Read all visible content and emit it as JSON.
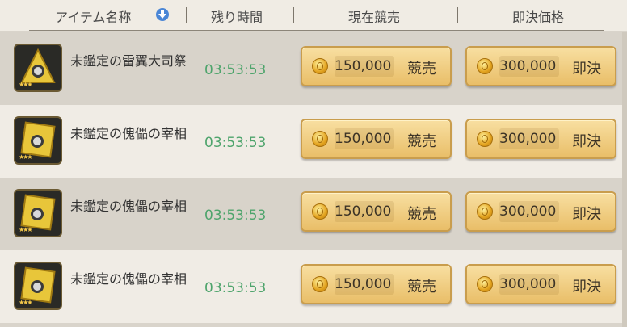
{
  "header": {
    "item_name": "アイテム名称",
    "remaining_time": "残り時間",
    "current_bid": "現在競売",
    "buyout_price": "即決価格"
  },
  "rows": [
    {
      "name": "未鑑定の雷翼大司祭",
      "time": "03:53:53",
      "bid_amount": "150,000",
      "bid_label": "競売",
      "buyout_amount": "300,000",
      "buyout_label": "即決",
      "icon": "winged-relic-icon",
      "stars": "★★★"
    },
    {
      "name": "未鑑定の傀儡の宰相",
      "time": "03:53:53",
      "bid_amount": "150,000",
      "bid_label": "競売",
      "buyout_amount": "300,000",
      "buyout_label": "即決",
      "icon": "puppet-card-icon",
      "stars": "★★★"
    },
    {
      "name": "未鑑定の傀儡の宰相",
      "time": "03:53:53",
      "bid_amount": "150,000",
      "bid_label": "競売",
      "buyout_amount": "300,000",
      "buyout_label": "即決",
      "icon": "puppet-card-icon",
      "stars": "★★★"
    },
    {
      "name": "未鑑定の傀儡の宰相",
      "time": "03:53:53",
      "bid_amount": "150,000",
      "bid_label": "競売",
      "buyout_amount": "300,000",
      "buyout_label": "即決",
      "icon": "puppet-card-icon",
      "stars": "★★★"
    }
  ],
  "colors": {
    "time_green": "#4ea46c",
    "button_gold": "#e9be68"
  }
}
